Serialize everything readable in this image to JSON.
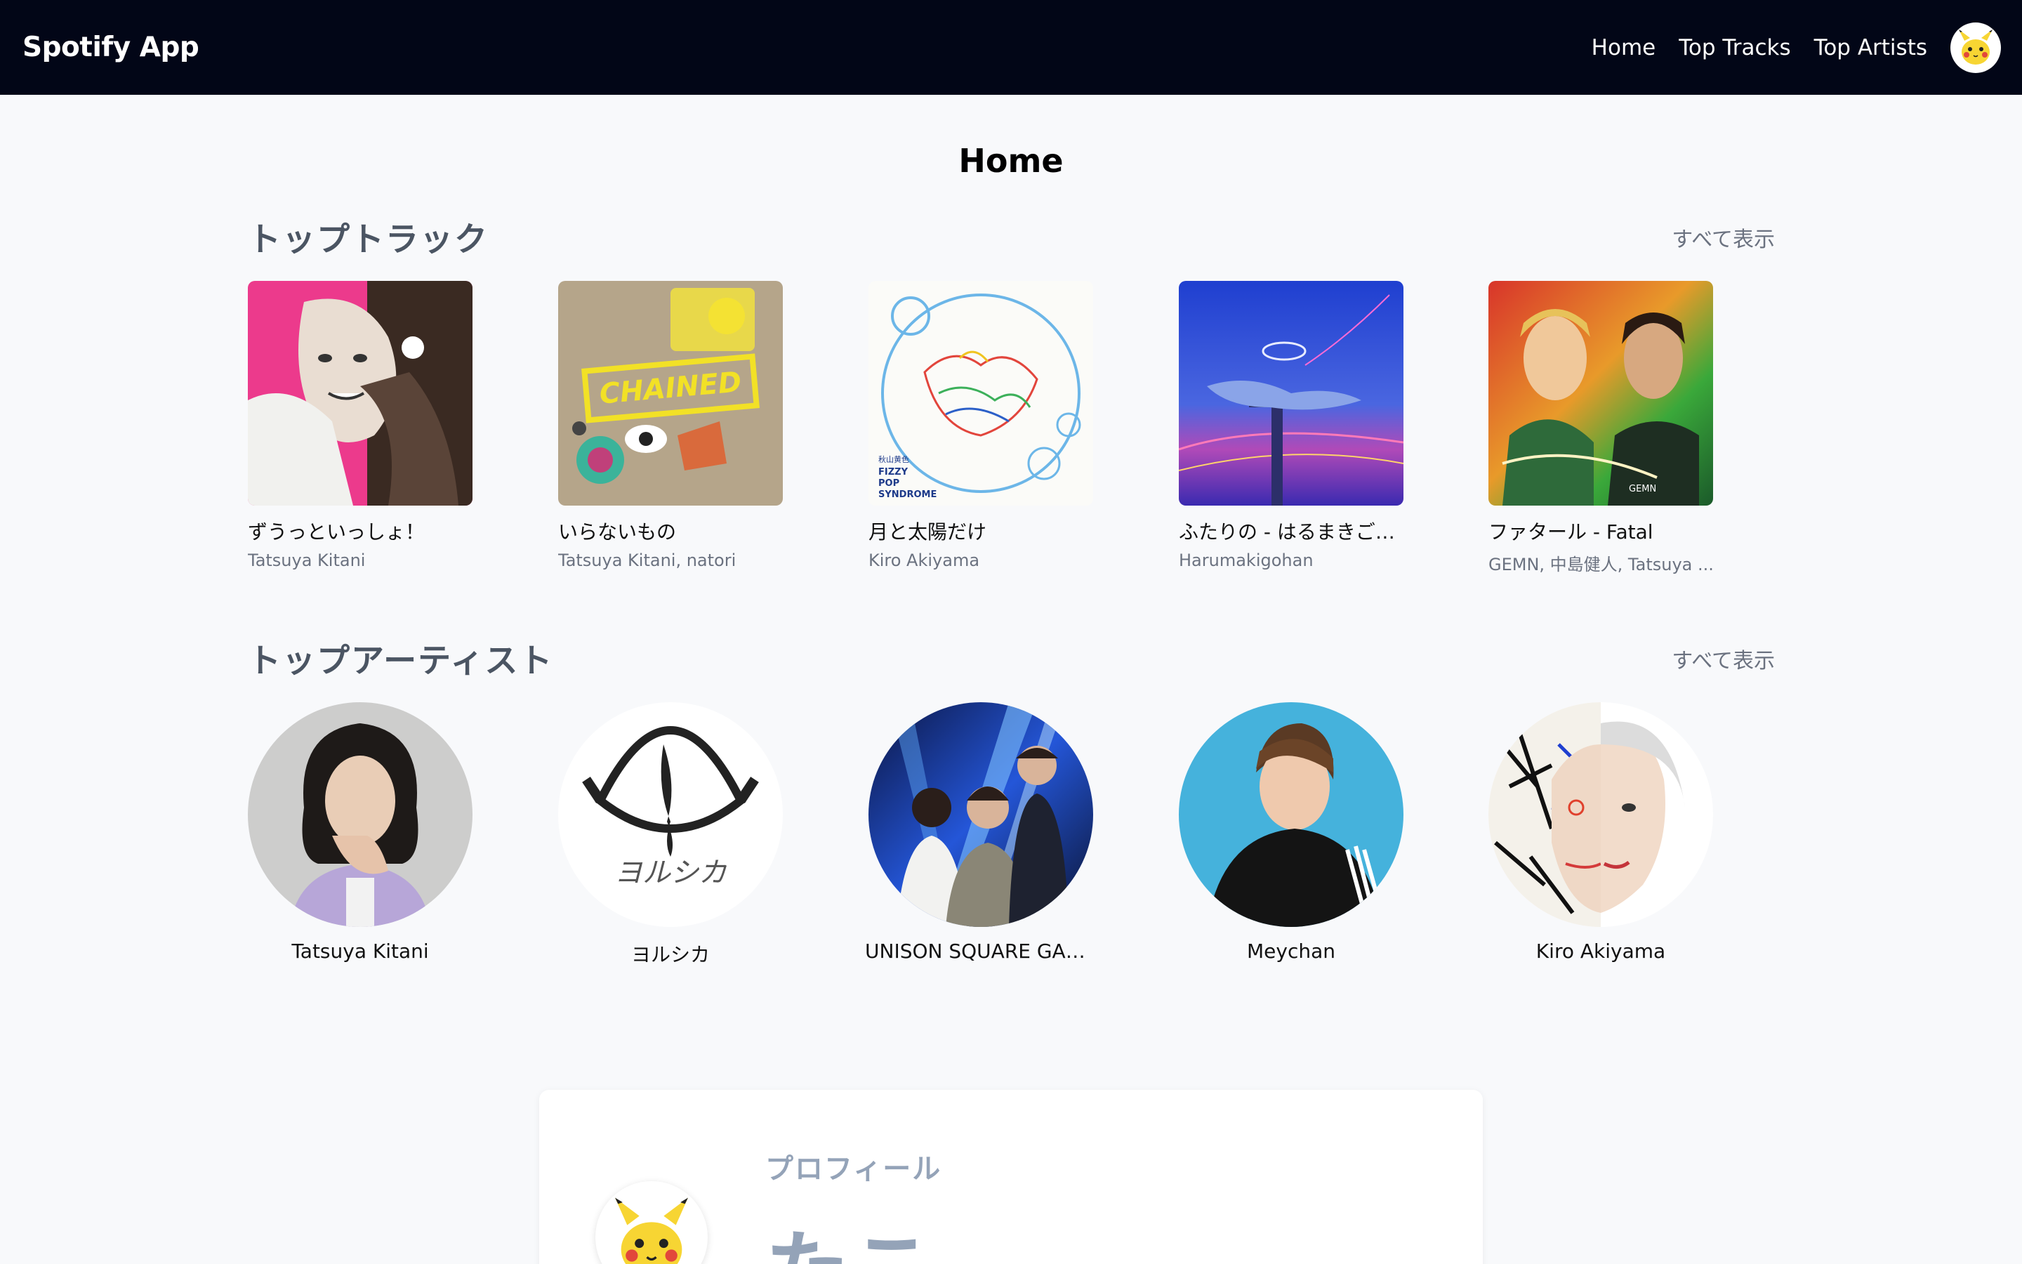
{
  "navbar": {
    "brand": "Spotify App",
    "links": [
      "Home",
      "Top Tracks",
      "Top Artists"
    ],
    "avatar_icon": "pikachu-avatar"
  },
  "page": {
    "title": "Home"
  },
  "top_tracks": {
    "heading": "トップトラック",
    "see_all": "すべて表示",
    "items": [
      {
        "name": "ずうっといっしょ！",
        "artist": "Tatsuya Kitani"
      },
      {
        "name": "いらないもの",
        "artist": "Tatsuya Kitani, natori"
      },
      {
        "name": "月と太陽だけ",
        "artist": "Kiro Akiyama"
      },
      {
        "name": "ふたりの - はるまきご…",
        "artist": "Harumakigohan"
      },
      {
        "name": "ファタール - Fatal",
        "artist": "GEMN, 中島健人, Tatsuya ..."
      }
    ],
    "cover_texts": {
      "chained": "CHAINED",
      "fizzy": [
        "秋山黄色",
        "FIZZY",
        "POP",
        "SYNDROME"
      ],
      "gemn": "GEMN"
    }
  },
  "top_artists": {
    "heading": "トップアーティスト",
    "see_all": "すべて表示",
    "items": [
      {
        "name": "Tatsuya Kitani"
      },
      {
        "name": "ヨルシカ"
      },
      {
        "name": "UNISON SQUARE GAR..."
      },
      {
        "name": "Meychan"
      },
      {
        "name": "Kiro Akiyama"
      }
    ],
    "yorushika_logo_text": "ヨルシカ"
  },
  "profile": {
    "label": "プロフィール",
    "name": "たこ"
  },
  "colors": {
    "navbar_bg": "#020617",
    "page_bg": "#f8f9fb",
    "section_heading": "#4b5563",
    "muted": "#6b7280",
    "profile_text": "#94a3b8"
  }
}
